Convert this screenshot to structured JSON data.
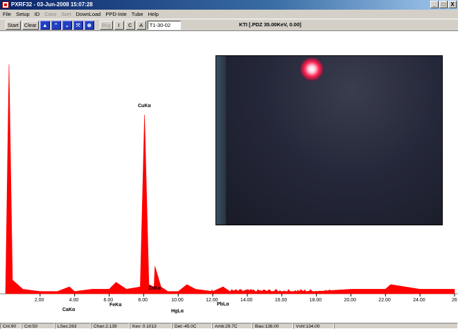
{
  "window": {
    "title": "PXRF32 - 03-Jun-2008 15:07:28",
    "buttons": {
      "minimize": "_",
      "maximize": "□",
      "close": "X"
    }
  },
  "menu": {
    "items": [
      "File",
      "Setup",
      "ID",
      "Conc",
      "Sort",
      "DownLoad",
      "PPD-Inte",
      "Tube",
      "Help"
    ],
    "disabled": [
      "Conc",
      "Sort"
    ]
  },
  "toolbar": {
    "start": "Start",
    "clear": "Clear",
    "bkg": "Bkg",
    "i": "I",
    "c": "C",
    "a": "A",
    "sample_value": "T1-30-02",
    "info": "KTI  [.PDZ 35.00KeV, 0.00]"
  },
  "spectrum": {
    "peak_labels": [
      "CuKα",
      "FeKα",
      "CaKα",
      "ZnKα",
      "HgLα",
      "PbLα"
    ],
    "x_ticks": [
      "2.00",
      "4.00",
      "6.00",
      "8.00",
      "10.00",
      "12.00",
      "14.00",
      "16.00",
      "18.00",
      "20.00",
      "22.00",
      "24.00",
      "26"
    ],
    "color": "#ff0000"
  },
  "chart_data": {
    "type": "area",
    "xlabel": "",
    "ylabel": "",
    "xlim": [
      0,
      26
    ],
    "x": [
      0.0,
      0.2,
      0.4,
      1.0,
      2.0,
      3.0,
      3.7,
      4.0,
      5.0,
      6.0,
      6.4,
      7.0,
      7.8,
      8.05,
      8.3,
      8.6,
      8.65,
      9.0,
      9.4,
      10.0,
      10.5,
      11.0,
      12.0,
      12.6,
      13.0,
      14.0,
      16.0,
      18.0,
      20.0,
      22.0,
      22.3,
      24.0,
      26.0
    ],
    "y": [
      0,
      100,
      6,
      2,
      1,
      1,
      3,
      1,
      2,
      2,
      5,
      2,
      3,
      78,
      4,
      3,
      12,
      3,
      1,
      1,
      4,
      2,
      1,
      3,
      1,
      1,
      1,
      1,
      2,
      2,
      4,
      2,
      2
    ]
  },
  "status": {
    "cells": [
      "Cnt:90",
      "Cnt:50",
      "LSec:263",
      "Chan:2.139",
      "Kev: 0.1013",
      "Det:-45.0C",
      "Amb:29.7C",
      "Bias:138.00",
      "Vshl:134.00"
    ]
  }
}
